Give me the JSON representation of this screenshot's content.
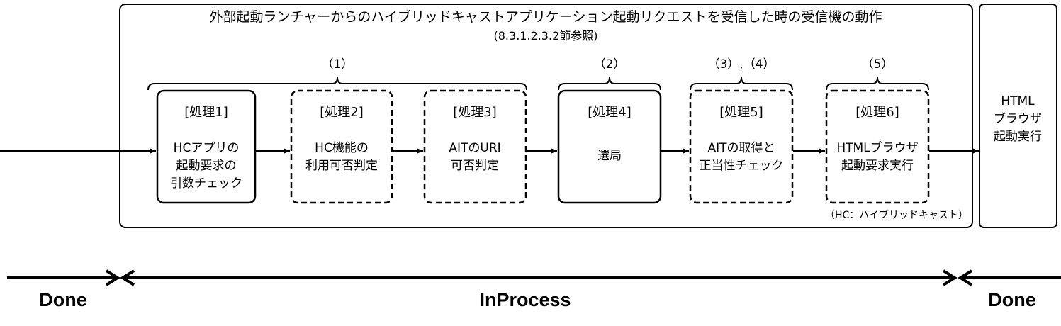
{
  "main_box": {
    "title": "外部起動ランチャーからのハイブリッドキャストアプリケーション起動リクエストを受信した時の受信機の動作",
    "subtitle": "(8.3.1.2.3.2節参照)",
    "footnote": "（HC：ハイブリッドキャスト）"
  },
  "groups": [
    {
      "label": "（1）"
    },
    {
      "label": "（2）"
    },
    {
      "label": "（3）,（4）"
    },
    {
      "label": "（5）"
    }
  ],
  "steps": [
    {
      "title": "[処理1]",
      "line1": "HCアプリの",
      "line2": "起動要求の",
      "line3": "引数チェック",
      "border": "solid"
    },
    {
      "title": "[処理2]",
      "line1": "HC機能の",
      "line2": "利用可否判定",
      "line3": "",
      "border": "dashed"
    },
    {
      "title": "[処理3]",
      "line1": "AITのURI",
      "line2": "可否判定",
      "line3": "",
      "border": "dashed"
    },
    {
      "title": "[処理4]",
      "line1": "選局",
      "line2": "",
      "line3": "",
      "border": "solid"
    },
    {
      "title": "[処理5]",
      "line1": "AITの取得と",
      "line2": "正当性チェック",
      "line3": "",
      "border": "dashed"
    },
    {
      "title": "[処理6]",
      "line1": "HTMLブラウザ",
      "line2": "起動要求実行",
      "line3": "",
      "border": "dashed"
    }
  ],
  "browser_box": {
    "line1": "HTML",
    "line2": "ブラウザ",
    "line3": "起動実行"
  },
  "states": {
    "left": "Done",
    "middle": "InProcess",
    "right": "Done"
  }
}
